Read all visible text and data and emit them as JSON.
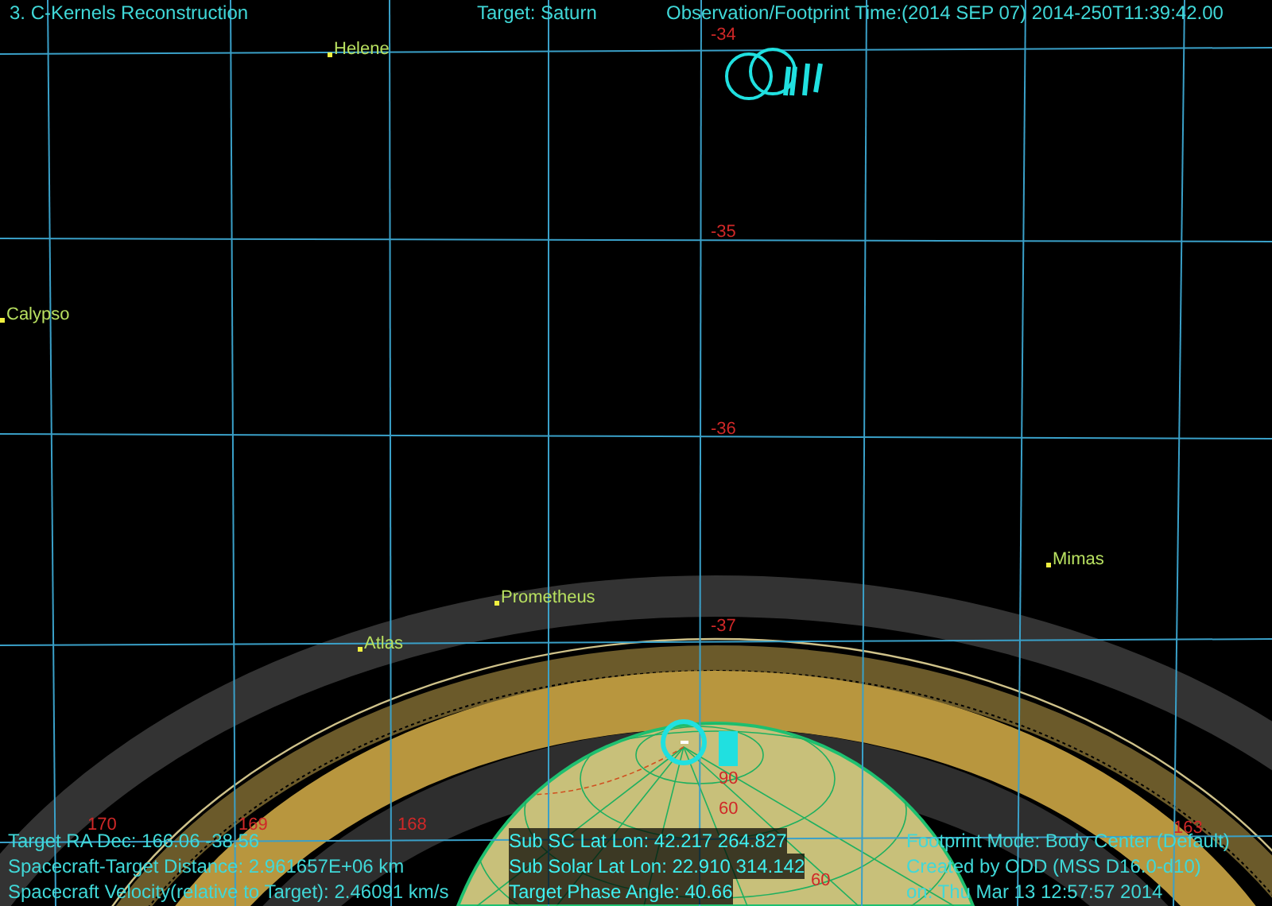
{
  "header": {
    "title": "3. C-Kernels Reconstruction",
    "target": "Target: Saturn",
    "time": "Observation/Footprint Time:(2014 SEP 07) 2014-250T11:39:42.00"
  },
  "moons": [
    "Helene",
    "Calypso",
    "Mimas",
    "Prometheus",
    "Atlas"
  ],
  "grid_labels": [
    "-34",
    "-35",
    "-36",
    "-37",
    "170",
    "169",
    "168",
    "163",
    "90",
    "60",
    "60"
  ],
  "info_left": [
    "Target RA Dec: 166.06  -38.56",
    "Spacecraft-Target Distance: 2.961657E+06 km",
    "Spacecraft Velocity(relative to Target): 2.46091 km/s"
  ],
  "info_middle": [
    "Sub SC Lat Lon: 42.217 264.827",
    "Sub Solar Lat Lon: 22.910 314.142",
    "Target Phase Angle: 40.66"
  ],
  "info_right": [
    "Footprint Mode: Body Center (Default)",
    "Created by ODD (MSS D16.0-d10)",
    "on: Thu Mar 13 12:57:57 2014"
  ]
}
